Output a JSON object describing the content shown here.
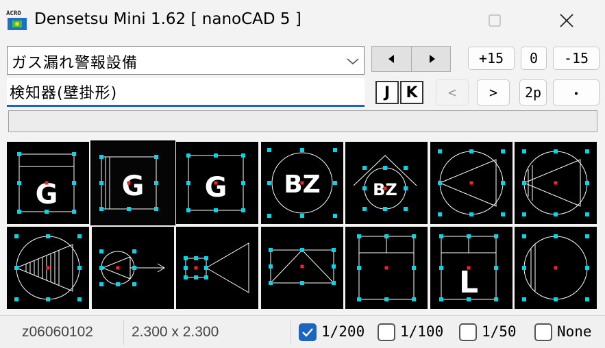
{
  "window": {
    "title": "Densetsu Mini 1.62 [ nanoCAD 5 ]",
    "app_icon_text": "ACRO",
    "maximize_icon": "maximize-icon",
    "close_icon": "close-icon"
  },
  "category_combo": {
    "value": "ガス漏れ警報設備"
  },
  "subtype_field": {
    "value": "検知器(壁掛形)"
  },
  "toolbar": {
    "prev_icon": "triangle-left-icon",
    "next_icon": "triangle-right-icon",
    "plus15": "+15",
    "zero": "0",
    "minus15": "-15",
    "j": "J",
    "k": "K",
    "back": "<",
    "forward": ">",
    "twop": "2p",
    "dot": "・"
  },
  "symbols": [
    {
      "id": "gas-detector-g-1",
      "label": "G"
    },
    {
      "id": "gas-detector-g-2",
      "label": "G"
    },
    {
      "id": "gas-detector-g-3",
      "label": "G"
    },
    {
      "id": "buzzer-circle",
      "label": "BZ"
    },
    {
      "id": "buzzer-roof",
      "label": "BZ"
    },
    {
      "id": "speaker-circle-1",
      "label": ""
    },
    {
      "id": "speaker-circle-2",
      "label": ""
    },
    {
      "id": "speaker-circle-hatched",
      "label": ""
    },
    {
      "id": "speaker-arrow",
      "label": ""
    },
    {
      "id": "speaker-horn",
      "label": ""
    },
    {
      "id": "box-triangle",
      "label": ""
    },
    {
      "id": "panel-box",
      "label": ""
    },
    {
      "id": "panel-l",
      "label": "L"
    },
    {
      "id": "circle-lines",
      "label": ""
    }
  ],
  "status": {
    "code": "z06060102",
    "size": "2.300 x 2.300",
    "scales": [
      {
        "label": "1/200",
        "checked": true
      },
      {
        "label": "1/100",
        "checked": false
      },
      {
        "label": "1/50",
        "checked": false
      },
      {
        "label": "None",
        "checked": false
      }
    ]
  },
  "colors": {
    "symbol_bg": "#000000",
    "grip": "#00d8e8",
    "center": "#ff2020",
    "line": "#ffffff",
    "accent": "#1b64c0"
  }
}
